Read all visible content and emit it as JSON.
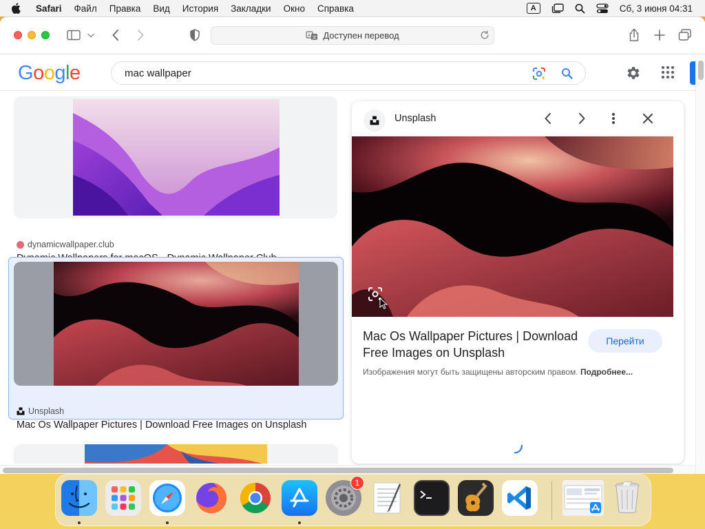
{
  "menubar": {
    "app": "Safari",
    "items": [
      "Файл",
      "Правка",
      "Вид",
      "История",
      "Закладки",
      "Окно",
      "Справка"
    ],
    "input_source": "A",
    "datetime": "Сб, 3 июня  04:31"
  },
  "safari": {
    "address_text": "Доступен перевод"
  },
  "google": {
    "logo": [
      "G",
      "o",
      "o",
      "g",
      "l",
      "e"
    ],
    "logo_colors": [
      "#4285f4",
      "#ea4335",
      "#fbbc05",
      "#4285f4",
      "#34a853",
      "#ea4335"
    ],
    "query": "mac wallpaper"
  },
  "results": [
    {
      "source": "dynamicwallpaper.club",
      "title": "Dynamic Wallpapers for macOS - Dynamic Wallpaper Club",
      "selected": false
    },
    {
      "source": "Unsplash",
      "title": "Mac Os Wallpaper Pictures | Download Free Images on Unsplash",
      "selected": true
    },
    {
      "source": "",
      "title": "",
      "selected": false
    }
  ],
  "preview": {
    "source_name": "Unsplash",
    "title": "Mac Os Wallpaper Pictures | Download Free Images on Unsplash",
    "visit_button": "Перейти",
    "copyright_notice": "Изображения могут быть защищены авторским правом.",
    "more_link": "Подробнее..."
  },
  "dock": {
    "apps": [
      "Finder",
      "Launchpad",
      "Safari",
      "Firefox",
      "Google Chrome",
      "App Store",
      "System Settings",
      "TextEdit",
      "Terminal",
      "GarageBand",
      "Visual Studio Code",
      "Preview",
      "Trash"
    ],
    "settings_badge": "1"
  },
  "colors": {
    "accent_blue": "#1a73e8",
    "selection_blue": "#8ab4f8",
    "button_bg": "#e8f0fe",
    "button_text": "#1967d2"
  }
}
